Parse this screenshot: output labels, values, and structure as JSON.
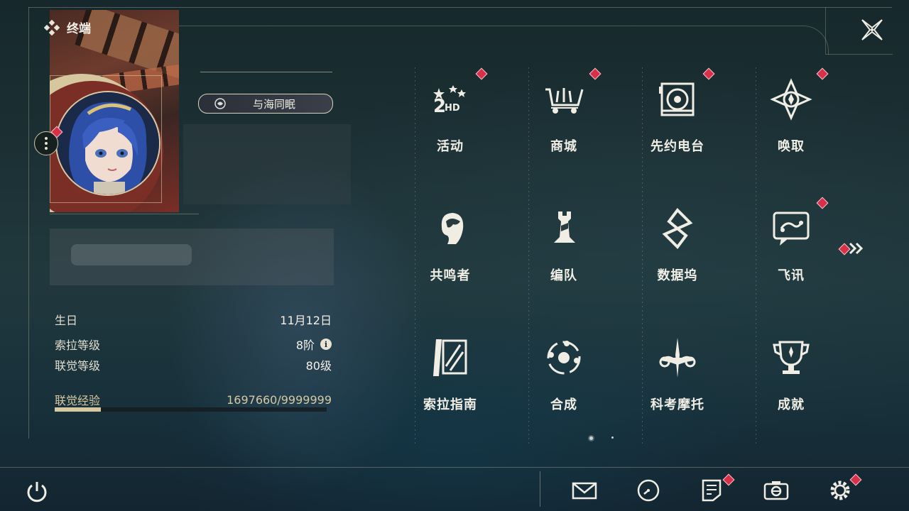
{
  "header": {
    "title": "终端"
  },
  "profile": {
    "title_badge": "与海同眠"
  },
  "info": {
    "birthday_label": "生日",
    "birthday_value": "11月12日",
    "sola_label": "索拉等级",
    "sola_value": "8阶",
    "union_label": "联觉等级",
    "union_value": "80级",
    "exp_label": "联觉经验",
    "exp_value": "1697660/9999999",
    "exp_progress": 0.17
  },
  "menu": {
    "items": [
      {
        "label": "活动",
        "icon": "events-2hd-icon",
        "badge": true
      },
      {
        "label": "商城",
        "icon": "shop-cart-icon",
        "badge": true
      },
      {
        "label": "先约电台",
        "icon": "radio-icon",
        "badge": true
      },
      {
        "label": "唤取",
        "icon": "convene-star-icon",
        "badge": true
      },
      {
        "label": "共鸣者",
        "icon": "resonator-head-icon",
        "badge": false
      },
      {
        "label": "编队",
        "icon": "team-chess-icon",
        "badge": false
      },
      {
        "label": "数据坞",
        "icon": "data-bank-icon",
        "badge": false
      },
      {
        "label": "飞讯",
        "icon": "message-bubble-icon",
        "badge": true
      },
      {
        "label": "索拉指南",
        "icon": "guide-book-icon",
        "badge": false
      },
      {
        "label": "合成",
        "icon": "synthesis-icon",
        "badge": false
      },
      {
        "label": "科考摩托",
        "icon": "motorcycle-icon",
        "badge": false
      },
      {
        "label": "成就",
        "icon": "trophy-icon",
        "badge": false
      }
    ],
    "pages": 2,
    "current_page": 1
  },
  "bottom_bar": {
    "icons": [
      "mail-icon",
      "clock-icon",
      "notice-icon",
      "camera-icon",
      "settings-gear-icon"
    ]
  },
  "colors": {
    "badge": "#d9304a",
    "accent": "#d6c9a0"
  }
}
